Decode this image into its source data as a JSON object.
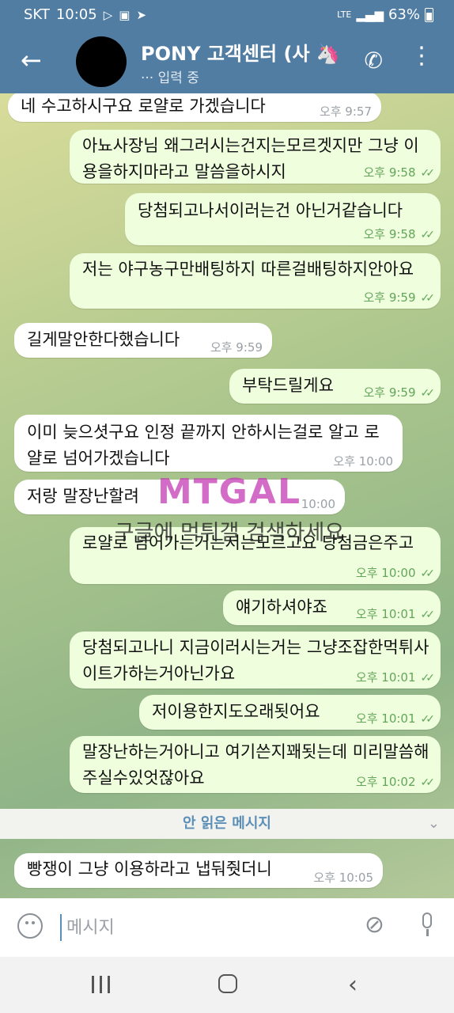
{
  "status_bar": {
    "carrier": "SKT",
    "time": "10:05",
    "network": "LTE",
    "battery": "63%"
  },
  "header": {
    "title": "PONY 고객센터 (사",
    "title_emoji": "🦄",
    "status": "··· 입력 중"
  },
  "messages": [
    {
      "dir": "in",
      "text": "네 수고하시구요 로얄로 가겠습니다",
      "time": "오후 9:57"
    },
    {
      "dir": "out",
      "text": "아뇨사장님 왜그러시는건지는모르겟지만 그냥 이용을하지마라고 말씀을하시지",
      "time": "오후 9:58"
    },
    {
      "dir": "out",
      "text": "당첨되고나서이러는건 아닌거같습니다",
      "time": "오후 9:58"
    },
    {
      "dir": "out",
      "text": "저는 야구농구만배팅하지 따른걸배팅하지안아요",
      "time": "오후 9:59"
    },
    {
      "dir": "in",
      "text": "길게말안한다했습니다",
      "time": "오후 9:59"
    },
    {
      "dir": "out",
      "text": "부탁드릴게요",
      "time": "오후 9:59"
    },
    {
      "dir": "in",
      "text": "이미 늦으셧구요 인정 끝까지 안하시는걸로 알고 로얄로 넘어가겠습니다",
      "time": "오후 10:00"
    },
    {
      "dir": "in",
      "text": "저랑 말장난할려",
      "time": "10:00"
    },
    {
      "dir": "out",
      "text": "로얄로 넘어가는거는저는모르고요 당첨금은주고",
      "time": "오후 10:00"
    },
    {
      "dir": "out",
      "text": "얘기하셔야죠",
      "time": "오후 10:01"
    },
    {
      "dir": "out",
      "text": "당첨되고나니 지금이러시는거는 그냥조잡한먹튀사이트가하는거아닌가요",
      "time": "오후 10:01"
    },
    {
      "dir": "out",
      "text": "저이용한지도오래됫어요",
      "time": "오후 10:01"
    },
    {
      "dir": "out",
      "text": "말장난하는거아니고 여기쓴지꽤됫는데 미리말씀해주실수있엇잖아요",
      "time": "오후 10:02"
    },
    {
      "dir": "in",
      "text": "빵쟁이 그냥 이용하라고 냅둬줫더니",
      "time": "오후 10:05"
    }
  ],
  "unread_divider": "안 읽은 메시지",
  "watermark": {
    "logo": "MTGAL",
    "text": "구글에 먹튀갤 검색하세요"
  },
  "composer": {
    "placeholder": "메시지"
  },
  "colors": {
    "header_bg": "#527da3",
    "outgoing_bubble": "#effedd",
    "incoming_bubble": "#ffffff",
    "read_check": "#63a65a"
  }
}
